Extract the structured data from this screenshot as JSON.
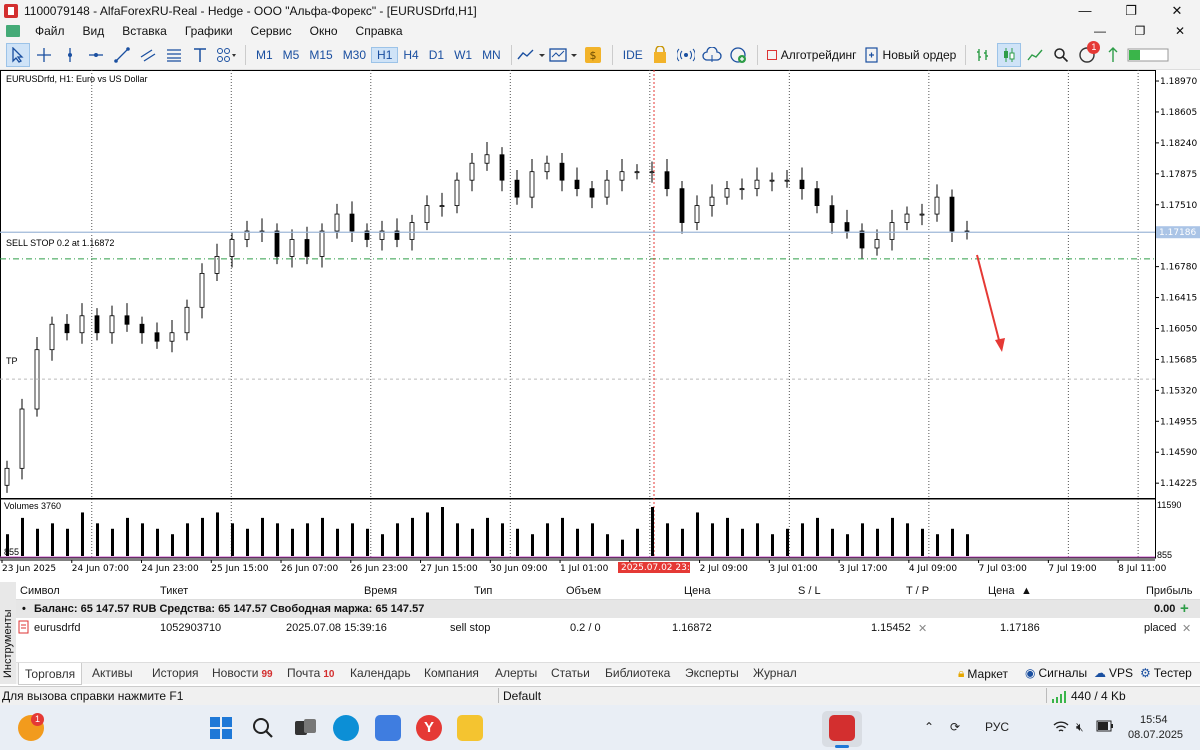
{
  "window": {
    "title": "1100079148 - AlfaForexRU-Real - Hedge - ООО \"Альфа-Форекс\" - [EURUSDrfd,H1]",
    "controls": [
      "—",
      "❐",
      "✕"
    ]
  },
  "menu": {
    "items": [
      "Файл",
      "Вид",
      "Вставка",
      "Графики",
      "Сервис",
      "Окно",
      "Справка"
    ],
    "right_controls": [
      "—",
      "❐",
      "✕"
    ]
  },
  "toolbar": {
    "timeframes": [
      "M1",
      "M5",
      "M15",
      "M30",
      "H1",
      "H4",
      "D1",
      "W1",
      "MN"
    ],
    "selected_timeframe": "H1",
    "ide_label": "IDE",
    "algo_label": "Алготрейдинг",
    "new_order_label": "Новый ордер",
    "notifications_count": "1"
  },
  "chart": {
    "symbol_label": "EURUSDrfd, H1:  Euro vs US Dollar",
    "order_line_label": "SELL STOP 0.2 at 1.16872",
    "tp_label": "TP",
    "volumes_label": "Volumes 3760",
    "volume_axis_top": "11590",
    "volume_axis_bottom": "855",
    "volume_left_label": "855",
    "current_price_label": "1.17186",
    "crosshair_time_label": "2025.07.02 23:00"
  },
  "chart_data": {
    "type": "candlestick",
    "symbol": "EURUSDrfd",
    "timeframe": "H1",
    "y_ticks": [
      1.1897,
      1.18605,
      1.1824,
      1.17875,
      1.1751,
      1.17186,
      1.1678,
      1.16415,
      1.1605,
      1.15685,
      1.1532,
      1.14955,
      1.1459,
      1.14225
    ],
    "ylim": [
      1.1405,
      1.191
    ],
    "x_ticks": [
      "23 Jun 2025",
      "24 Jun 07:00",
      "24 Jun 23:00",
      "25 Jun 15:00",
      "26 Jun 07:00",
      "26 Jun 23:00",
      "27 Jun 15:00",
      "30 Jun 09:00",
      "1 Jul 01:00",
      "1 Jul 17:00",
      "2 Jul 09:00",
      "3 Jul 01:00",
      "3 Jul 17:00",
      "4 Jul 09:00",
      "7 Jul 03:00",
      "7 Jul 19:00",
      "8 Jul 11:00"
    ],
    "close_path": [
      1.144,
      1.151,
      1.158,
      1.161,
      1.16,
      1.162,
      1.16,
      1.162,
      1.161,
      1.16,
      1.159,
      1.16,
      1.163,
      1.167,
      1.169,
      1.171,
      1.172,
      1.172,
      1.169,
      1.171,
      1.169,
      1.172,
      1.174,
      1.172,
      1.171,
      1.172,
      1.171,
      1.173,
      1.175,
      1.175,
      1.178,
      1.18,
      1.181,
      1.178,
      1.176,
      1.179,
      1.18,
      1.178,
      1.177,
      1.176,
      1.178,
      1.179,
      1.179,
      1.179,
      1.177,
      1.173,
      1.175,
      1.176,
      1.177,
      1.177,
      1.178,
      1.178,
      1.178,
      1.177,
      1.175,
      1.173,
      1.172,
      1.17,
      1.171,
      1.173,
      1.174,
      1.174,
      1.176,
      1.172,
      1.1719
    ],
    "volumes": [
      4,
      7,
      5,
      6,
      5,
      8,
      6,
      5,
      7,
      6,
      5,
      4,
      6,
      7,
      8,
      6,
      5,
      7,
      6,
      5,
      6,
      7,
      5,
      6,
      5,
      4,
      6,
      7,
      8,
      9,
      6,
      5,
      7,
      6,
      5,
      4,
      6,
      7,
      5,
      6,
      4,
      3,
      5,
      9,
      6,
      5,
      8,
      6,
      7,
      5,
      6,
      4,
      5,
      6,
      7,
      5,
      4,
      6,
      5,
      7,
      6,
      5,
      4,
      5,
      4
    ],
    "current_price": 1.17186,
    "sell_stop_price": 1.16872,
    "take_profit_price": 1.15452
  },
  "table": {
    "headers": {
      "symbol": "Символ",
      "ticket": "Тикет",
      "time": "Время",
      "type": "Тип",
      "volume": "Объем",
      "price": "Цена",
      "sl": "S / L",
      "tp": "T / P",
      "cur_price": "Цена",
      "profit": "Прибыль"
    },
    "balance_line": "Баланс: 65 147.57 RUB  Средства: 65 147.57  Свободная маржа: 65 147.57",
    "balance_profit": "0.00",
    "order": {
      "symbol": "eurusdrfd",
      "ticket": "1052903710",
      "time": "2025.07.08 15:39:16",
      "type": "sell stop",
      "volume": "0.2 / 0",
      "price": "1.16872",
      "sl": "",
      "tp": "1.15452",
      "cur_price": "1.17186",
      "status": "placed"
    }
  },
  "side_tab_label": "Инструменты",
  "bottom_tabs": {
    "items": [
      {
        "label": "Торговля",
        "count": ""
      },
      {
        "label": "Активы",
        "count": ""
      },
      {
        "label": "История",
        "count": ""
      },
      {
        "label": "Новости",
        "count": "99"
      },
      {
        "label": "Почта",
        "count": "10"
      },
      {
        "label": "Календарь",
        "count": ""
      },
      {
        "label": "Компания",
        "count": ""
      },
      {
        "label": "Алерты",
        "count": ""
      },
      {
        "label": "Статьи",
        "count": ""
      },
      {
        "label": "Библиотека",
        "count": ""
      },
      {
        "label": "Эксперты",
        "count": ""
      },
      {
        "label": "Журнал",
        "count": ""
      }
    ],
    "right": [
      "Маркет",
      "Сигналы",
      "VPS",
      "Тестер"
    ]
  },
  "statusbar": {
    "help": "Для вызова справки нажмите F1",
    "profile": "Default",
    "traffic": "440 / 4 Kb"
  },
  "taskbar": {
    "weather_badge": "1",
    "tray_lang": "РУС",
    "time": "15:54",
    "date": "08.07.2025",
    "colors": {
      "windows": "#1e78d7",
      "edge": "#0c8fd6",
      "store": "#3f7de0",
      "yandex": "#e53935",
      "explorer": "#f4c430",
      "mt5": "#d32f2f"
    }
  }
}
